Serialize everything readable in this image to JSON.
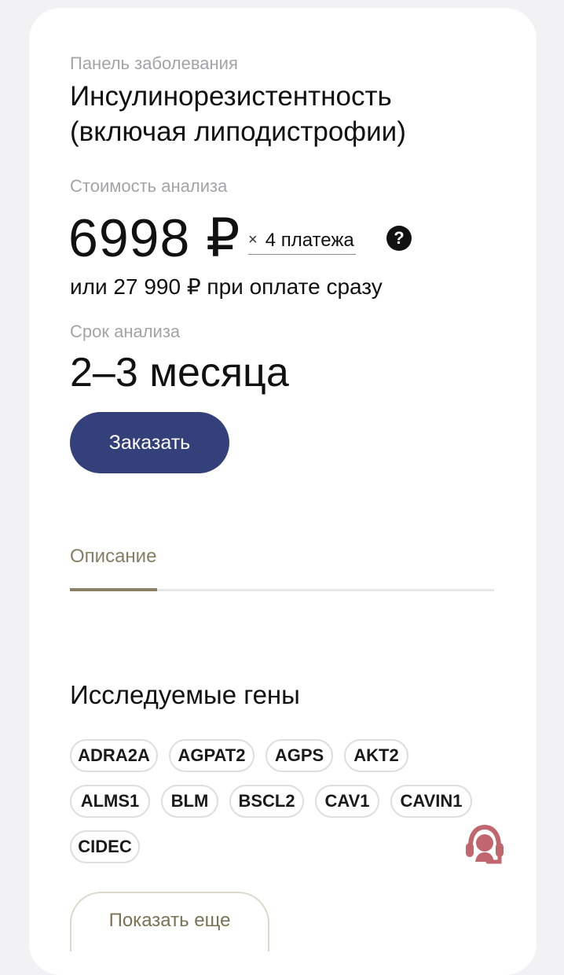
{
  "product": {
    "panel_label": "Панель заболевания",
    "title": "Инсулинорезистентность (включая липодистрофии)"
  },
  "pricing": {
    "cost_label": "Стоимость анализа",
    "installment_price": "6998 ₽",
    "installments_times": "×",
    "installments_text": "4 платежа",
    "help_icon": "?",
    "full_price_text": "или 27 990 ₽ при оплате сразу"
  },
  "term": {
    "label": "Срок анализа",
    "value": "2–3 месяца"
  },
  "actions": {
    "order_label": "Заказать",
    "show_more_label": "Показать еще"
  },
  "tabs": [
    {
      "label": "Описание",
      "active": true
    }
  ],
  "genes": {
    "title": "Исследуемые гены",
    "items": [
      "ADRA2A",
      "AGPAT2",
      "AGPS",
      "AKT2",
      "ALMS1",
      "BLM",
      "BSCL2",
      "CAV1",
      "CAVIN1",
      "CIDEC"
    ]
  },
  "icons": {
    "help": "help-circle-icon",
    "support": "support-operator-icon"
  },
  "colors": {
    "primary_button": "#34407a",
    "accent": "#8a8267",
    "support_icon": "#c1666f"
  }
}
